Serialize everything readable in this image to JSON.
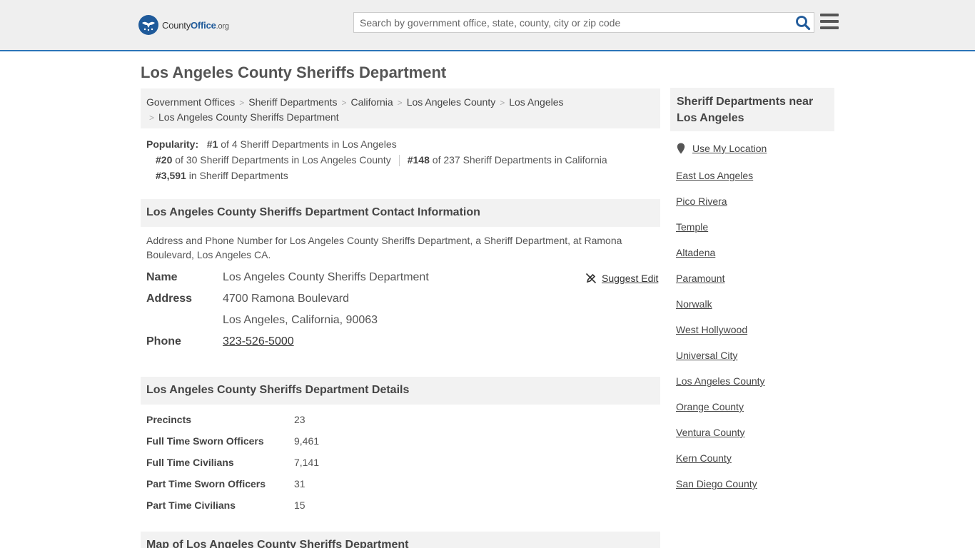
{
  "header": {
    "logo_prefix": "County",
    "logo_bold": "Office",
    "logo_suffix": ".org",
    "search_placeholder": "Search by government office, state, county, city or zip code",
    "accent_color": "#2b75b8"
  },
  "page_title": "Los Angeles County Sheriffs Department",
  "breadcrumb": [
    "Government Offices",
    "Sheriff Departments",
    "California",
    "Los Angeles County",
    "Los Angeles",
    "Los Angeles County Sheriffs Department"
  ],
  "popularity": {
    "label": "Popularity:",
    "r1_rank": "#1",
    "r1_text": " of 4 Sheriff Departments in Los Angeles",
    "r2_rank": "#20",
    "r2_text": " of 30 Sheriff Departments in Los Angeles County",
    "r3_rank": "#148",
    "r3_text": " of 237 Sheriff Departments in California",
    "r4_rank": "#3,591",
    "r4_text": " in Sheriff Departments"
  },
  "contact": {
    "heading": "Los Angeles County Sheriffs Department Contact Information",
    "description": "Address and Phone Number for Los Angeles County Sheriffs Department, a Sheriff Department, at Ramona Boulevard, Los Angeles CA.",
    "name_label": "Name",
    "name_value": "Los Angeles County Sheriffs Department",
    "address_label": "Address",
    "address_line1": "4700 Ramona Boulevard",
    "address_line2": "Los Angeles, California, 90063",
    "phone_label": "Phone",
    "phone_value": "323-526-5000",
    "suggest_edit": "Suggest Edit"
  },
  "details": {
    "heading": "Los Angeles County Sheriffs Department Details",
    "rows": [
      {
        "label": "Precincts",
        "value": "23"
      },
      {
        "label": "Full Time Sworn Officers",
        "value": "9,461"
      },
      {
        "label": "Full Time Civilians",
        "value": "7,141"
      },
      {
        "label": "Part Time Sworn Officers",
        "value": "31"
      },
      {
        "label": "Part Time Civilians",
        "value": "15"
      }
    ]
  },
  "map": {
    "heading": "Map of Los Angeles County Sheriffs Department"
  },
  "sidebar": {
    "heading": "Sheriff Departments near Los Angeles",
    "use_location": "Use My Location",
    "links": [
      "East Los Angeles",
      "Pico Rivera",
      "Temple",
      "Altadena",
      "Paramount",
      "Norwalk",
      "West Hollywood",
      "Universal City",
      "Los Angeles County",
      "Orange County",
      "Ventura County",
      "Kern County",
      "San Diego County"
    ]
  }
}
